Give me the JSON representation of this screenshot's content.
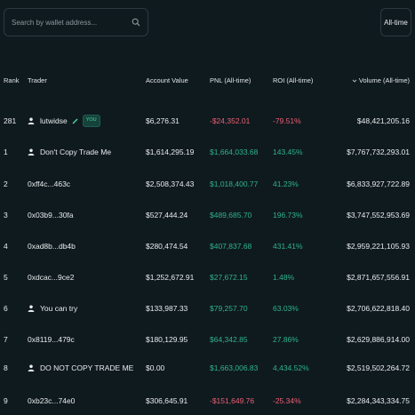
{
  "search": {
    "placeholder": "Search by wallet address...",
    "icon": "search-icon"
  },
  "time_filter": {
    "label": "All-time"
  },
  "columns": {
    "rank": "Rank",
    "trader": "Trader",
    "account_value": "Account Value",
    "pnl": "PNL (All-time)",
    "roi": "ROI (All-time)",
    "volume": "Volume (All-time)"
  },
  "rows": [
    {
      "rank": "281",
      "trader": "lutwidse",
      "user_icon": true,
      "is_you": true,
      "account_value": "$6,276.31",
      "pnl": "-$24,352.01",
      "pnl_sign": "neg",
      "roi": "-79.51%",
      "roi_sign": "neg",
      "volume": "$48,421,205.16"
    },
    {
      "rank": "1",
      "trader": "Don't Copy Trade Me",
      "user_icon": true,
      "is_you": false,
      "account_value": "$1,614,295.19",
      "pnl": "$1,664,033.68",
      "pnl_sign": "pos",
      "roi": "143.45%",
      "roi_sign": "pos",
      "volume": "$7,767,732,293.01"
    },
    {
      "rank": "2",
      "trader": "0xff4c...463c",
      "user_icon": false,
      "is_you": false,
      "account_value": "$2,508,374.43",
      "pnl": "$1,018,400.77",
      "pnl_sign": "pos",
      "roi": "41.23%",
      "roi_sign": "pos",
      "volume": "$6,833,927,722.89"
    },
    {
      "rank": "3",
      "trader": "0x03b9...30fa",
      "user_icon": false,
      "is_you": false,
      "account_value": "$527,444.24",
      "pnl": "$489,685.70",
      "pnl_sign": "pos",
      "roi": "196.73%",
      "roi_sign": "pos",
      "volume": "$3,747,552,953.69"
    },
    {
      "rank": "4",
      "trader": "0xad8b...db4b",
      "user_icon": false,
      "is_you": false,
      "account_value": "$280,474.54",
      "pnl": "$407,837.68",
      "pnl_sign": "pos",
      "roi": "431.41%",
      "roi_sign": "pos",
      "volume": "$2,959,221,105.93"
    },
    {
      "rank": "5",
      "trader": "0xdcac...9ce2",
      "user_icon": false,
      "is_you": false,
      "account_value": "$1,252,672.91",
      "pnl": "$27,672.15",
      "pnl_sign": "pos",
      "roi": "1.48%",
      "roi_sign": "pos",
      "volume": "$2,871,657,556.91"
    },
    {
      "rank": "6",
      "trader": "You can try",
      "user_icon": true,
      "is_you": false,
      "account_value": "$133,987.33",
      "pnl": "$79,257.70",
      "pnl_sign": "pos",
      "roi": "63.03%",
      "roi_sign": "pos",
      "volume": "$2,706,622,818.40"
    },
    {
      "rank": "7",
      "trader": "0x8119...479c",
      "user_icon": false,
      "is_you": false,
      "account_value": "$180,129.95",
      "pnl": "$64,342.85",
      "pnl_sign": "pos",
      "roi": "27.86%",
      "roi_sign": "pos",
      "volume": "$2,629,886,914.00"
    },
    {
      "rank": "8",
      "trader": "DO NOT COPY TRADE ME",
      "user_icon": true,
      "is_you": false,
      "account_value": "$0.00",
      "pnl": "$1,663,006.83",
      "pnl_sign": "pos",
      "roi": "4,434.52%",
      "roi_sign": "pos",
      "volume": "$2,519,502,264.72"
    },
    {
      "rank": "9",
      "trader": "0xb23c...74e0",
      "user_icon": false,
      "is_you": false,
      "account_value": "$306,645.91",
      "pnl": "-$151,649.76",
      "pnl_sign": "neg",
      "roi": "-25.34%",
      "roi_sign": "neg",
      "volume": "$2,284,343,334.75"
    }
  ],
  "badges": {
    "you": "YOU"
  },
  "colors": {
    "background": "#0f1a1f",
    "positive": "#2fb38a",
    "negative": "#ed5e72",
    "accent": "#48d6a0"
  }
}
